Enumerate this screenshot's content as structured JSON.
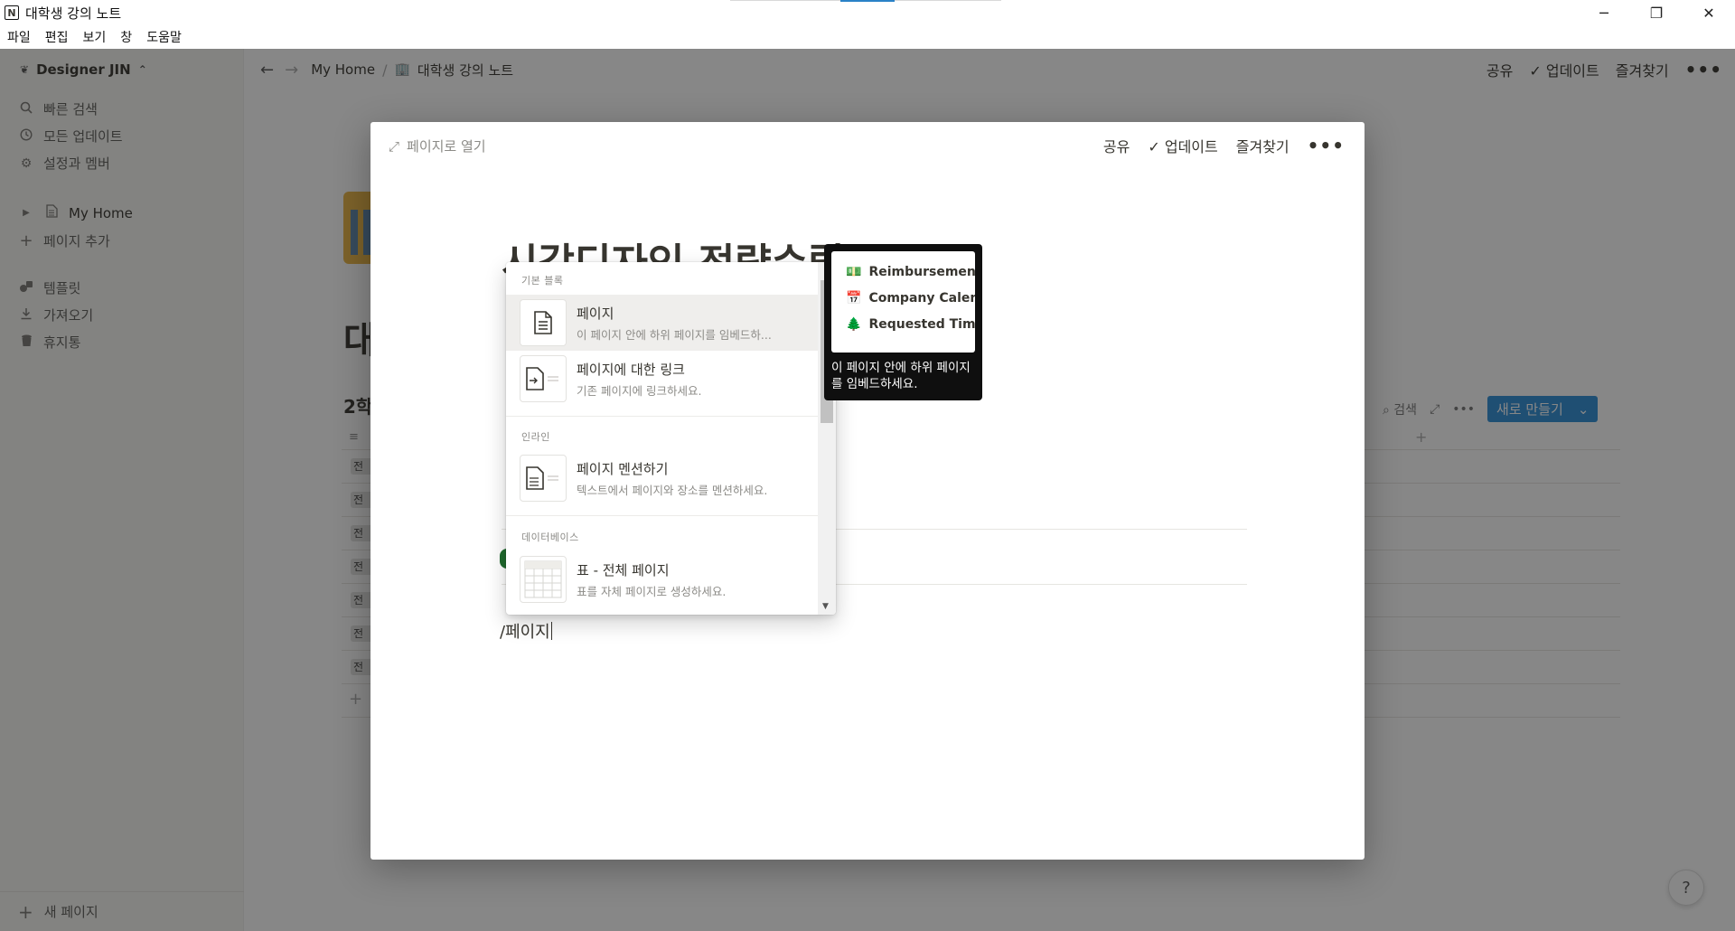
{
  "window": {
    "title": "대학생 강의 노트",
    "logo": "N",
    "minimize": "─",
    "maximize": "❐",
    "close": "✕"
  },
  "menu": [
    "파일",
    "편집",
    "보기",
    "창",
    "도움말"
  ],
  "sidebar": {
    "workspace": "Designer JIN",
    "items": [
      {
        "label": "빠른 검색",
        "icon": "search-icon"
      },
      {
        "label": "모든 업데이트",
        "icon": "clock-icon"
      },
      {
        "label": "설정과 멤버",
        "icon": "gear-icon"
      },
      {
        "label": "My Home",
        "icon": "page-icon"
      },
      {
        "label": "페이지 추가",
        "icon": "plus-icon"
      },
      {
        "label": "템플릿",
        "icon": "shapes-icon"
      },
      {
        "label": "가져오기",
        "icon": "download-icon"
      },
      {
        "label": "휴지통",
        "icon": "trash-icon"
      }
    ],
    "new_page": "새 페이지"
  },
  "topbar": {
    "breadcrumb_home": "My Home",
    "breadcrumb_page": "대학생 강의 노트",
    "share": "공유",
    "updates": "업데이트",
    "favorite": "즐겨찾기"
  },
  "background": {
    "title": "대",
    "heading": "2학",
    "search": "검색",
    "new_button": "새로 만들기",
    "tag_text": "전"
  },
  "modal": {
    "open_as_page": "페이지로 열기",
    "share": "공유",
    "updates": "업데이트",
    "favorite": "즐겨찾기",
    "page_title": "시각디자인 전략수립 OO",
    "slash_input": "/페이지"
  },
  "dropdown": {
    "sections": [
      "기본 블록",
      "인라인",
      "데이터베이스"
    ],
    "items": [
      {
        "name": "페이지",
        "desc": "이 페이지 안에 하위 페이지를 임베드하..."
      },
      {
        "name": "페이지에 대한 링크",
        "desc": "기존 페이지에 링크하세요."
      },
      {
        "name": "페이지 멘션하기",
        "desc": "텍스트에서 페이지와 장소를 멘션하세요."
      },
      {
        "name": "표 - 전체 페이지",
        "desc": "표를 자체 페이지로 생성하세요."
      }
    ]
  },
  "tooltip": {
    "preview": [
      {
        "emoji": "💵",
        "label": "Reimbursement"
      },
      {
        "emoji": "📅",
        "label": "Company Calendar"
      },
      {
        "emoji": "🌲",
        "label": "Requested Time"
      }
    ],
    "text": "이 페이지 안에 하위 페이지를 임베드하세요."
  },
  "help": "?"
}
